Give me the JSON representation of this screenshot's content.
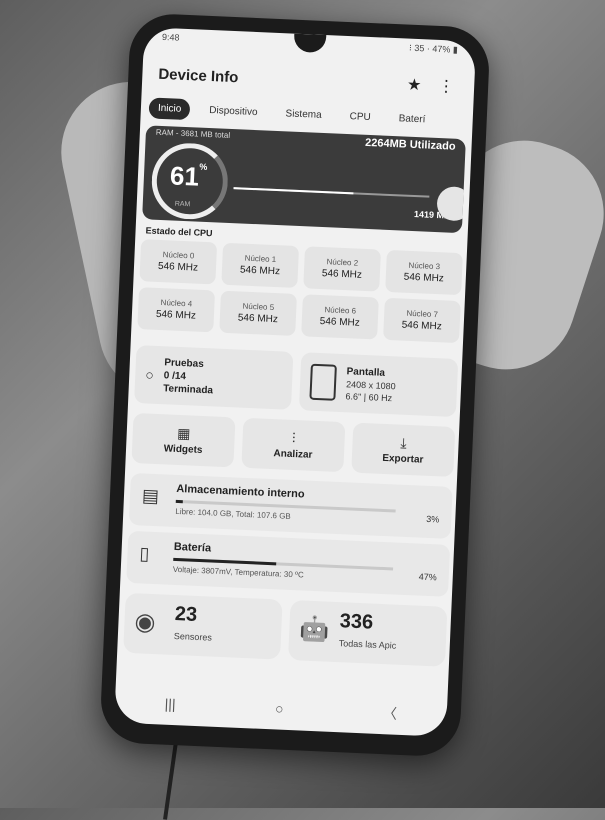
{
  "status": {
    "time": "9:48",
    "right": "⁝ 35 · 47% ▮"
  },
  "app": {
    "title": "Device Info"
  },
  "tabs": [
    {
      "label": "Inicio",
      "active": true
    },
    {
      "label": "Dispositivo",
      "active": false
    },
    {
      "label": "Sistema",
      "active": false
    },
    {
      "label": "CPU",
      "active": false
    },
    {
      "label": "Baterí",
      "active": false
    }
  ],
  "ram": {
    "title": "RAM - 3681 MB total",
    "used": "2264MB Utilizado",
    "percent": "61",
    "percent_symbol": "%",
    "label": "RAM",
    "free": "1419 MB",
    "fill": 0.61
  },
  "cpu": {
    "title": "Estado del CPU",
    "cores": [
      {
        "name": "Núcleo 0",
        "freq": "546 MHz"
      },
      {
        "name": "Núcleo 1",
        "freq": "546 MHz"
      },
      {
        "name": "Núcleo 2",
        "freq": "546 MHz"
      },
      {
        "name": "Núcleo 3",
        "freq": "546 MHz"
      },
      {
        "name": "Núcleo 4",
        "freq": "546 MHz"
      },
      {
        "name": "Núcleo 5",
        "freq": "546 MHz"
      },
      {
        "name": "Núcleo 6",
        "freq": "546 MHz"
      },
      {
        "name": "Núcleo 7",
        "freq": "546 MHz"
      }
    ]
  },
  "tests": {
    "title": "Pruebas",
    "count": "0 /14",
    "status": "Terminada"
  },
  "display": {
    "title": "Pantalla",
    "resolution": "2408 x 1080",
    "info": "6.6\" | 60 Hz"
  },
  "actions": {
    "widgets": "Widgets",
    "analyze": "Analizar",
    "export": "Exportar"
  },
  "storage": {
    "title": "Almacenamiento interno",
    "detail": "Libre: 104.0 GB, Total: 107.6 GB",
    "percent": "3%",
    "fill": 0.03
  },
  "battery": {
    "title": "Batería",
    "detail": "Voltaje: 3807mV, Temperatura: 30 ºC",
    "percent": "47%",
    "fill": 0.47
  },
  "sensors": {
    "count": "23",
    "label": "Sensores"
  },
  "apps": {
    "count": "336",
    "label": "Todas las Apic"
  },
  "icons": {
    "star": "star-icon",
    "more": "more-vert-icon",
    "widgets": "widgets-icon",
    "analyze": "analytics-icon",
    "export": "download-icon",
    "storage": "storage-icon",
    "battery": "battery-icon",
    "sensors": "sensor-icon",
    "apps": "android-icon"
  }
}
